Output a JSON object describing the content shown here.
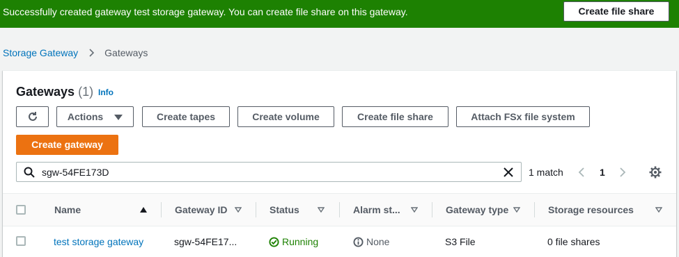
{
  "flash": {
    "message": "Successfully created gateway test storage gateway. You can create file share on this gateway.",
    "button_label": "Create file share"
  },
  "breadcrumb": {
    "items": [
      "Storage Gateway",
      "Gateways"
    ]
  },
  "panel": {
    "title": "Gateways",
    "count": "(1)",
    "info_label": "Info",
    "buttons": {
      "actions": "Actions",
      "create_tapes": "Create tapes",
      "create_volume": "Create volume",
      "create_file_share": "Create file share",
      "attach_fsx": "Attach FSx file system",
      "create_gateway": "Create gateway"
    },
    "search": {
      "value": "sgw-54FE173D"
    },
    "pagination": {
      "match_text": "1 match",
      "current_page": "1"
    },
    "table": {
      "columns": [
        "Name",
        "Gateway ID",
        "Status",
        "Alarm st...",
        "Gateway type",
        "Storage resources"
      ],
      "rows": [
        {
          "name": "test storage gateway",
          "gateway_id": "sgw-54FE17...",
          "status": "Running",
          "alarm_state": "None",
          "gateway_type": "S3 File",
          "storage_resources": "0 file shares"
        }
      ]
    }
  },
  "colors": {
    "success": "#1d8102",
    "primary": "#ec7211",
    "link": "#0073bb"
  }
}
